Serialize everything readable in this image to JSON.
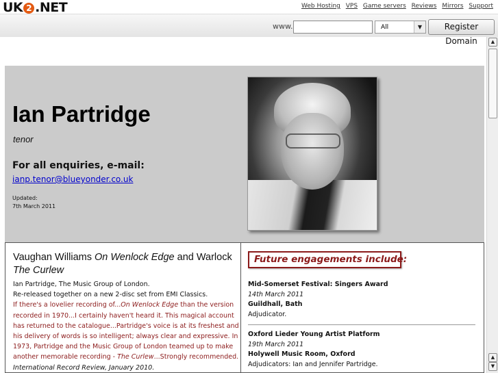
{
  "topbar": {
    "logo_pre": "UK",
    "logo_ring": "2",
    "logo_post": ".NET",
    "links": [
      "Web Hosting",
      "VPS",
      "Game servers",
      "Reviews",
      "Mirrors",
      "Support"
    ]
  },
  "domainbar": {
    "www_label": "www.",
    "input_value": "",
    "tld_selected": "All",
    "register_label": "Register Domain"
  },
  "hero": {
    "name": "Ian Partridge",
    "voice": "tenor",
    "enquiries": "For all enquiries, e-mail:",
    "email": "ianp.tenor@blueyonder.co.uk",
    "updated_label": "Updated:",
    "updated_date": "7th March 2011"
  },
  "recording": {
    "title_a": "Vaughan Williams ",
    "title_work1": "On Wenlock Edge",
    "title_b": " and Warlock ",
    "title_work2": "The Curlew",
    "line1": "Ian Partridge, The Music Group of London.",
    "line2": "Re-released together on a new 2-disc set from EMI Classics.",
    "review_a": "If there's a lovelier recording of...",
    "review_work1": "On Wenlock Edge",
    "review_b": " than the version recorded in 1970...I certainly haven't heard it. This magical account has returned to the catalogue...Partridge's voice is at its freshest and his delivery of words is so intelligent; always clear and expressive. In 1973, Partridge and the Music Group of London teamed up to make another memorable recording - ",
    "review_work2": "The Curlew",
    "review_c": "...Strongly recommended. ",
    "review_source": "International Record Review, January 2010."
  },
  "engagements": {
    "heading": "Future engagements include:",
    "items": [
      {
        "event": "Mid-Somerset Festival: Singers Award",
        "date": "14th March 2011",
        "venue": "Guildhall, Bath",
        "role": "Adjudicator."
      },
      {
        "event": "Oxford Lieder Young Artist Platform",
        "date": "19th March 2011",
        "venue": "Holywell Music Room, Oxford",
        "role": "Adjudicators: Ian and Jennifer Partridge."
      }
    ]
  },
  "colors": {
    "accent_red": "#8b1a1a",
    "link_blue": "#0000cc",
    "hero_gray": "#cbcbcb",
    "logo_orange": "#e35a12"
  },
  "icons": {
    "select_arrow": "dropdown-arrow-icon",
    "scroll_up": "scroll-up-arrow-icon",
    "scroll_down": "scroll-down-arrow-icon"
  }
}
